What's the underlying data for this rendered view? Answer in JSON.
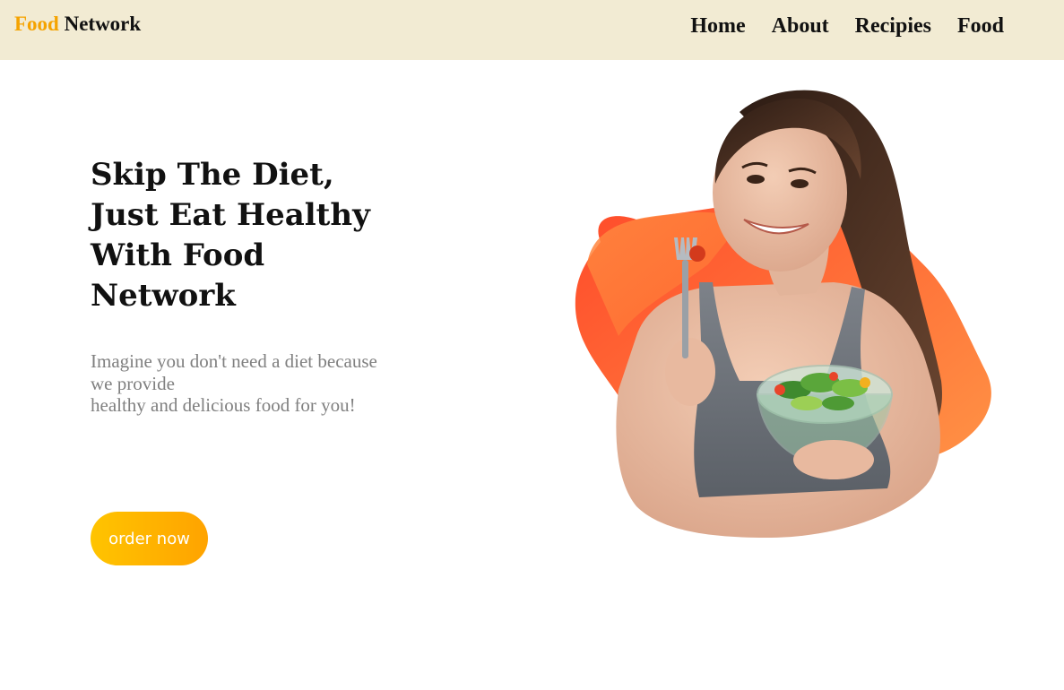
{
  "brand": {
    "accent_word": "Food",
    "rest_word": " Network",
    "accent_color": "#f5a300"
  },
  "nav": {
    "items": [
      {
        "label": "Home"
      },
      {
        "label": "About"
      },
      {
        "label": "Recipies"
      },
      {
        "label": "Food"
      }
    ]
  },
  "hero": {
    "title_lines": [
      "Skip The Diet,",
      "Just Eat Healthy",
      "With Food",
      "Network"
    ],
    "description_lines": [
      "Imagine you don't need a diet because",
      "we provide",
      "healthy and delicious food for you!"
    ],
    "cta_label": "order now"
  },
  "colors": {
    "navbar_bg": "#f2ebd3",
    "blob_gradient": [
      "#ff4a2a",
      "#ff9a48"
    ],
    "button_gradient": [
      "#ffc400",
      "#ffa300"
    ]
  },
  "image": {
    "subject": "woman-eating-salad-photo"
  }
}
